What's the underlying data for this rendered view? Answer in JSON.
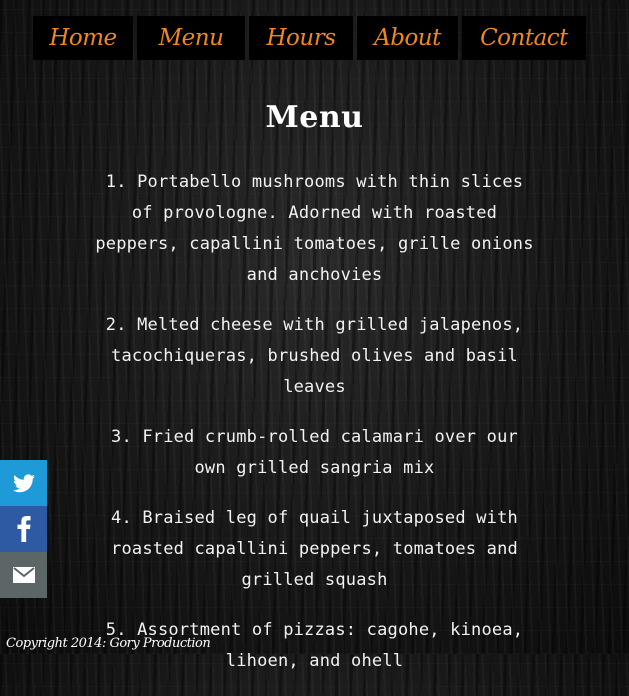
{
  "nav": {
    "items": [
      {
        "label": "Home"
      },
      {
        "label": "Menu"
      },
      {
        "label": "Hours"
      },
      {
        "label": "About"
      },
      {
        "label": "Contact"
      }
    ]
  },
  "page": {
    "title": "Menu"
  },
  "menu": {
    "items": [
      "1. Portabello mushrooms with thin slices of provolognе. Adorned with roasted peppers, capallini tomatoes, grille onions and anchovies",
      "2. Melted cheese with grilled jalapenos, tacochiqueras, brushed olives and basil leaves",
      "3. Fried crumb-rolled calamari over our own grilled sangria mix",
      "4. Braised leg of quail juxtaposed with roasted capallini peppers, tomatoes and grilled squash",
      "5. Assortment of pizzas: cagohe, kinoea, lihoen, and ohell"
    ]
  },
  "share": {
    "buttons": [
      {
        "icon": "twitter-icon",
        "color": "#1f9ad8"
      },
      {
        "icon": "facebook-icon",
        "color": "#2e5aa3"
      },
      {
        "icon": "email-icon",
        "color": "#5d6667"
      }
    ]
  },
  "footer": {
    "copyright": "Copyright 2014: Gory Production"
  },
  "colors": {
    "accent": "#f0861c",
    "nav_background": "#000000",
    "text": "#f2f2f2"
  }
}
